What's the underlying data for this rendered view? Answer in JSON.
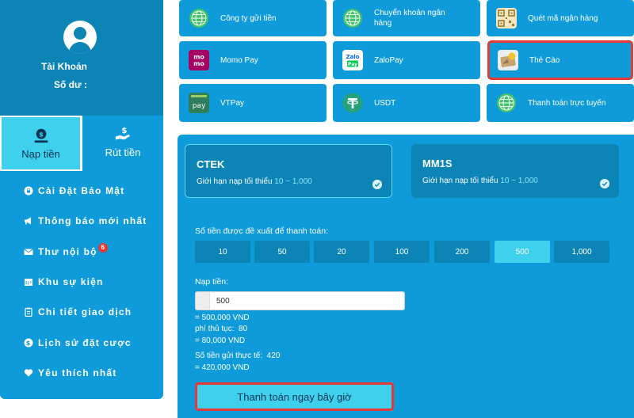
{
  "sidebar": {
    "account_label": "Tài Khoản",
    "balance_label": "Số dư :",
    "tabs": [
      {
        "label": "Nạp tiền",
        "icon": "deposit-icon",
        "active": true
      },
      {
        "label": "Rút tiền",
        "icon": "withdraw-icon",
        "active": false
      }
    ],
    "menu": [
      {
        "label": "Cài Đặt Bảo Mật",
        "icon": "lock-icon"
      },
      {
        "label": "Thông báo mới nhất",
        "icon": "megaphone-icon"
      },
      {
        "label": "Thư nội bộ",
        "icon": "envelope-icon",
        "badge": "6"
      },
      {
        "label": "Khu sự kiện",
        "icon": "calendar-icon"
      },
      {
        "label": "Chi tiết giao dịch",
        "icon": "clipboard-icon"
      },
      {
        "label": "Lịch sử đặt cược",
        "icon": "dollar-icon"
      },
      {
        "label": "Yêu thích nhất",
        "icon": "heart-icon"
      }
    ]
  },
  "methods": [
    {
      "label": "Công ty gửi tiền",
      "icon": "globe-icon"
    },
    {
      "label": "Chuyển khoản ngân hàng",
      "icon": "globe-icon"
    },
    {
      "label": "Quét mã ngân hàng",
      "icon": "qr-code-icon"
    },
    {
      "label": "Momo Pay",
      "icon": "momo-logo-icon",
      "logo_text": "mo mo"
    },
    {
      "label": "ZaloPay",
      "icon": "zalopay-logo-icon",
      "logo_text": "Zalo Pay"
    },
    {
      "label": "Thẻ Cào",
      "icon": "scratch-card-icon",
      "highlighted": true
    },
    {
      "label": "VTPay",
      "icon": "vtpay-logo-icon",
      "logo_text": "pay"
    },
    {
      "label": "USDT",
      "icon": "tether-icon"
    },
    {
      "label": "Thanh toán trực tuyến",
      "icon": "globe-icon"
    }
  ],
  "providers": [
    {
      "name": "CTEK",
      "limit_prefix": "Giới hạn nạp tối thiểu",
      "limit_range": "10 ~ 1,000",
      "selected": true
    },
    {
      "name": "MM1S",
      "limit_prefix": "Giới hạn nạp tối thiểu",
      "limit_range": "10 ~ 1,000",
      "selected": false
    }
  ],
  "deposit": {
    "suggest_label": "Số tiền được đề xuất để thanh toán:",
    "amounts": [
      "10",
      "50",
      "20",
      "100",
      "200",
      "500",
      "1,000"
    ],
    "active_amount": "500",
    "input_label": "Nạp tiền:",
    "input_value": "500",
    "converted": "= 500,000 VND",
    "fee_label": "phí thủ tục:",
    "fee_value": "80",
    "fee_converted": "= 80,000 VND",
    "actual_label": "Số tiền gửi thực tế:",
    "actual_value": "420",
    "actual_converted": "= 420,000 VND",
    "submit_label": "Thanh toán ngay bây giờ"
  },
  "colors": {
    "primary": "#0f9bd9",
    "dark": "#0d84b6",
    "accent": "#3fd0ee",
    "highlight": "#e53935"
  }
}
